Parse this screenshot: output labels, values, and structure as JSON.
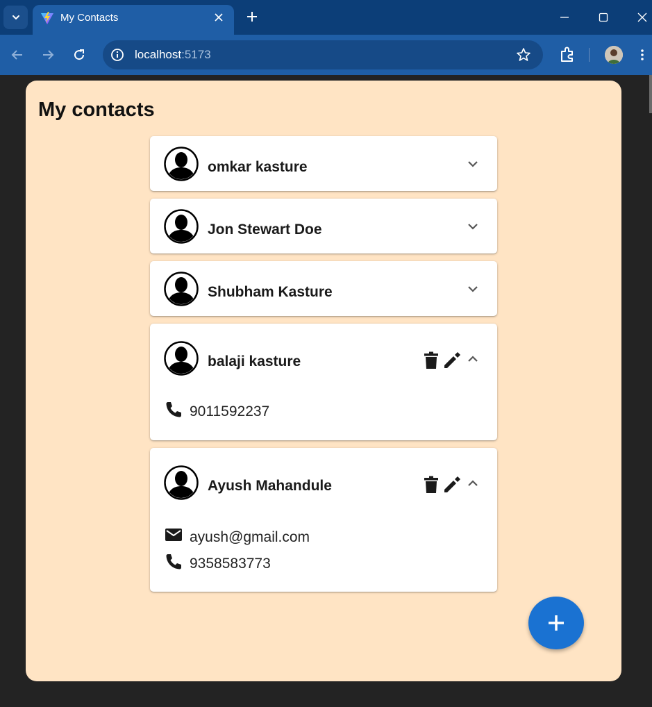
{
  "browser": {
    "tab_title": "My Contacts",
    "url_host": "localhost",
    "url_port": ":5173"
  },
  "page": {
    "title": "My contacts"
  },
  "contacts": [
    {
      "name": "omkar kasture",
      "expanded": false
    },
    {
      "name": "Jon Stewart Doe",
      "expanded": false
    },
    {
      "name": "Shubham Kasture",
      "expanded": false
    },
    {
      "name": "balaji kasture",
      "expanded": true,
      "phone": "9011592237"
    },
    {
      "name": "Ayush Mahandule",
      "expanded": true,
      "email": "ayush@gmail.com",
      "phone": "9358583773"
    }
  ],
  "icons": {
    "avatar": "account-silhouette-icon",
    "expand": "chevron-down-icon",
    "collapse": "chevron-up-icon",
    "delete": "trash-icon",
    "edit": "pencil-icon",
    "phone": "phone-icon",
    "email": "email-icon",
    "add": "plus-icon"
  },
  "colors": {
    "page_background": "#ffe4c4",
    "fab": "#1a72d2",
    "chrome_titlebar": "#0c3e78",
    "chrome_toolbar": "#1f5ea6"
  }
}
